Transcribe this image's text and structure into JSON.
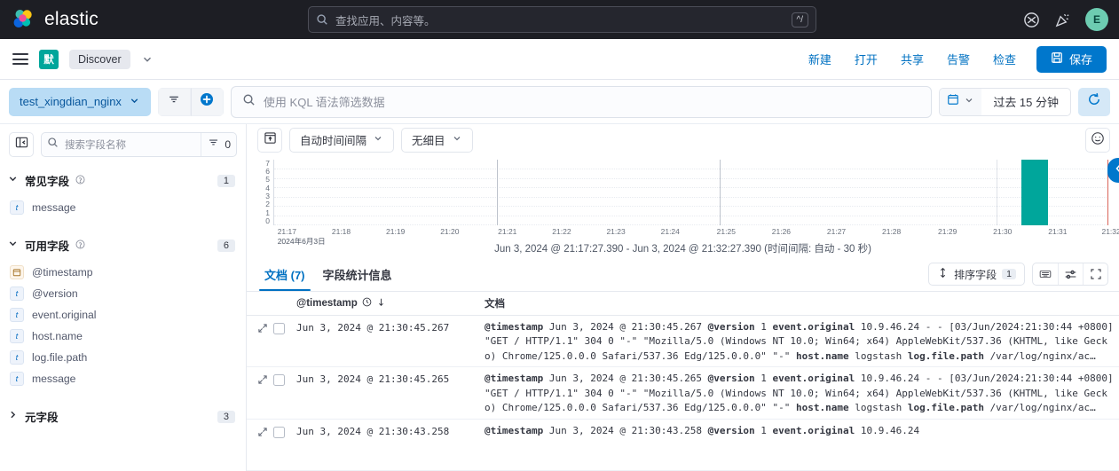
{
  "global_header": {
    "brand": "elastic",
    "search_placeholder": "查找应用、内容等。",
    "kbd_hint": "^/",
    "icons": [
      "help-icon",
      "announcements-icon"
    ],
    "avatar_initial": "E"
  },
  "app_bar": {
    "space_badge": "默",
    "breadcrumb": "Discover",
    "links": [
      "新建",
      "打开",
      "共享",
      "告警",
      "检查"
    ],
    "save_label": "保存"
  },
  "query_bar": {
    "data_view": "test_xingdian_nginx",
    "kql_placeholder": "使用 KQL 语法筛选数据",
    "date_range": "过去 15 分钟"
  },
  "sidebar": {
    "search_placeholder": "搜索字段名称",
    "filter_count": "0",
    "sections": [
      {
        "title": "常见字段",
        "count": "1",
        "expanded": true,
        "fields": [
          {
            "name": "message",
            "type": "t"
          }
        ]
      },
      {
        "title": "可用字段",
        "count": "6",
        "expanded": true,
        "fields": [
          {
            "name": "@timestamp",
            "type": "date"
          },
          {
            "name": "@version",
            "type": "t"
          },
          {
            "name": "event.original",
            "type": "t"
          },
          {
            "name": "host.name",
            "type": "t"
          },
          {
            "name": "log.file.path",
            "type": "t"
          },
          {
            "name": "message",
            "type": "t"
          }
        ]
      },
      {
        "title": "元字段",
        "count": "3",
        "expanded": false,
        "fields": []
      }
    ]
  },
  "chart_toolbar": {
    "interval_label": "自动时间间隔",
    "breakdown_label": "无细目"
  },
  "chart_data": {
    "type": "bar",
    "title": "",
    "caption": "Jun 3, 2024 @ 21:17:27.390 - Jun 3, 2024 @ 21:32:27.390  (时间间隔: 自动 - 30 秒)",
    "xlabel": "",
    "ylabel": "",
    "ylim": [
      0,
      7
    ],
    "yticks": [
      "7",
      "6",
      "5",
      "4",
      "3",
      "2",
      "1",
      "0"
    ],
    "grid": true,
    "date_label": "2024年6月3日",
    "xticks": [
      "21:17",
      "21:18",
      "21:19",
      "21:20",
      "21:21",
      "21:22",
      "21:23",
      "21:24",
      "21:25",
      "21:26",
      "21:27",
      "21:28",
      "21:29",
      "21:30",
      "21:31",
      "21:32"
    ],
    "categories": [
      "21:17",
      "21:17:30",
      "21:18",
      "21:18:30",
      "21:19",
      "21:19:30",
      "21:20",
      "21:20:30",
      "21:21",
      "21:21:30",
      "21:22",
      "21:22:30",
      "21:23",
      "21:23:30",
      "21:24",
      "21:24:30",
      "21:25",
      "21:25:30",
      "21:26",
      "21:26:30",
      "21:27",
      "21:27:30",
      "21:28",
      "21:28:30",
      "21:29",
      "21:29:30",
      "21:30",
      "21:30:30",
      "21:31",
      "21:31:30"
    ],
    "values": [
      0,
      0,
      0,
      0,
      0,
      0,
      0,
      0,
      0,
      0,
      0,
      0,
      0,
      0,
      0,
      0,
      0,
      0,
      0,
      0,
      0,
      0,
      0,
      0,
      0,
      0,
      0,
      7,
      0,
      0
    ],
    "bar_color": "#00a69b",
    "bar_time": "21:30:30",
    "bar_value": 7
  },
  "results": {
    "tabs": [
      {
        "label": "文档 (7)",
        "active": true
      },
      {
        "label": "字段统计信息",
        "active": false
      }
    ],
    "sort_label": "排序字段",
    "sort_count": "1",
    "columns": [
      "@timestamp",
      "文档"
    ],
    "rows": [
      {
        "timestamp": "Jun 3, 2024 @ 21:30:45.267",
        "doc": [
          {
            "key": "@timestamp",
            "val": "Jun 3, 2024 @ 21:30:45.267"
          },
          {
            "key": "@version",
            "val": "1"
          },
          {
            "key": "event.original",
            "val": "10.9.46.24 - - [03/Jun/2024:21:30:44 +0800] \"GET / HTTP/1.1\" 304 0 \"-\" \"Mozilla/5.0 (Windows NT 10.0; Win64; x64) AppleWebKit/537.36 (KHTML, like Gecko) Chrome/125.0.0.0 Safari/537.36 Edg/125.0.0.0\" \"-\""
          },
          {
            "key": "host.name",
            "val": "logstash"
          },
          {
            "key": "log.file.path",
            "val": "/var/log/nginx/ac…"
          }
        ]
      },
      {
        "timestamp": "Jun 3, 2024 @ 21:30:45.265",
        "doc": [
          {
            "key": "@timestamp",
            "val": "Jun 3, 2024 @ 21:30:45.265"
          },
          {
            "key": "@version",
            "val": "1"
          },
          {
            "key": "event.original",
            "val": "10.9.46.24 - - [03/Jun/2024:21:30:44 +0800] \"GET / HTTP/1.1\" 304 0 \"-\" \"Mozilla/5.0 (Windows NT 10.0; Win64; x64) AppleWebKit/537.36 (KHTML, like Gecko) Chrome/125.0.0.0 Safari/537.36 Edg/125.0.0.0\" \"-\""
          },
          {
            "key": "host.name",
            "val": "logstash"
          },
          {
            "key": "log.file.path",
            "val": "/var/log/nginx/ac…"
          }
        ]
      },
      {
        "timestamp": "Jun 3, 2024 @ 21:30:43.258",
        "doc": [
          {
            "key": "@timestamp",
            "val": "Jun 3, 2024 @ 21:30:43.258"
          },
          {
            "key": "@version",
            "val": "1"
          },
          {
            "key": "event.original",
            "val": "10.9.46.24"
          }
        ]
      }
    ]
  },
  "colors": {
    "accent": "#0077cc",
    "bar": "#00a69b",
    "header_bg": "#1d1e24",
    "space_badge": "#00a69b"
  }
}
